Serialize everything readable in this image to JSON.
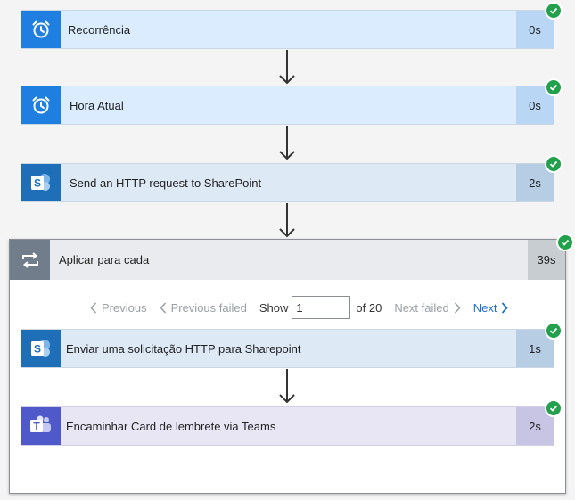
{
  "steps": [
    {
      "title": "Recorrência",
      "duration": "0s",
      "icon": "alarm-clock-icon"
    },
    {
      "title": "Hora Atual",
      "duration": "0s",
      "icon": "alarm-clock-icon"
    },
    {
      "title": "Send an HTTP request to SharePoint",
      "duration": "2s",
      "icon": "sharepoint-icon"
    }
  ],
  "loop": {
    "title": "Aplicar para cada",
    "duration": "39s",
    "icon": "loop-icon",
    "pager": {
      "previous": "Previous",
      "previous_failed": "Previous failed",
      "show": "Show",
      "current": "1",
      "of": "of 20",
      "next_failed": "Next failed",
      "next": "Next"
    },
    "steps": [
      {
        "title": "Enviar uma solicitação HTTP para Sharepoint",
        "duration": "1s",
        "icon": "sharepoint-icon"
      },
      {
        "title": "Encaminhar Card de lembrete via Teams",
        "duration": "2s",
        "icon": "teams-icon"
      }
    ]
  },
  "colors": {
    "clock_blue": "#1f7fe0",
    "sharepoint_blue": "#1e6fb7",
    "teams_purple": "#5059c9",
    "loop_gray": "#717d8b",
    "success_green": "#22a04b",
    "link_blue": "#1f6fd1"
  }
}
